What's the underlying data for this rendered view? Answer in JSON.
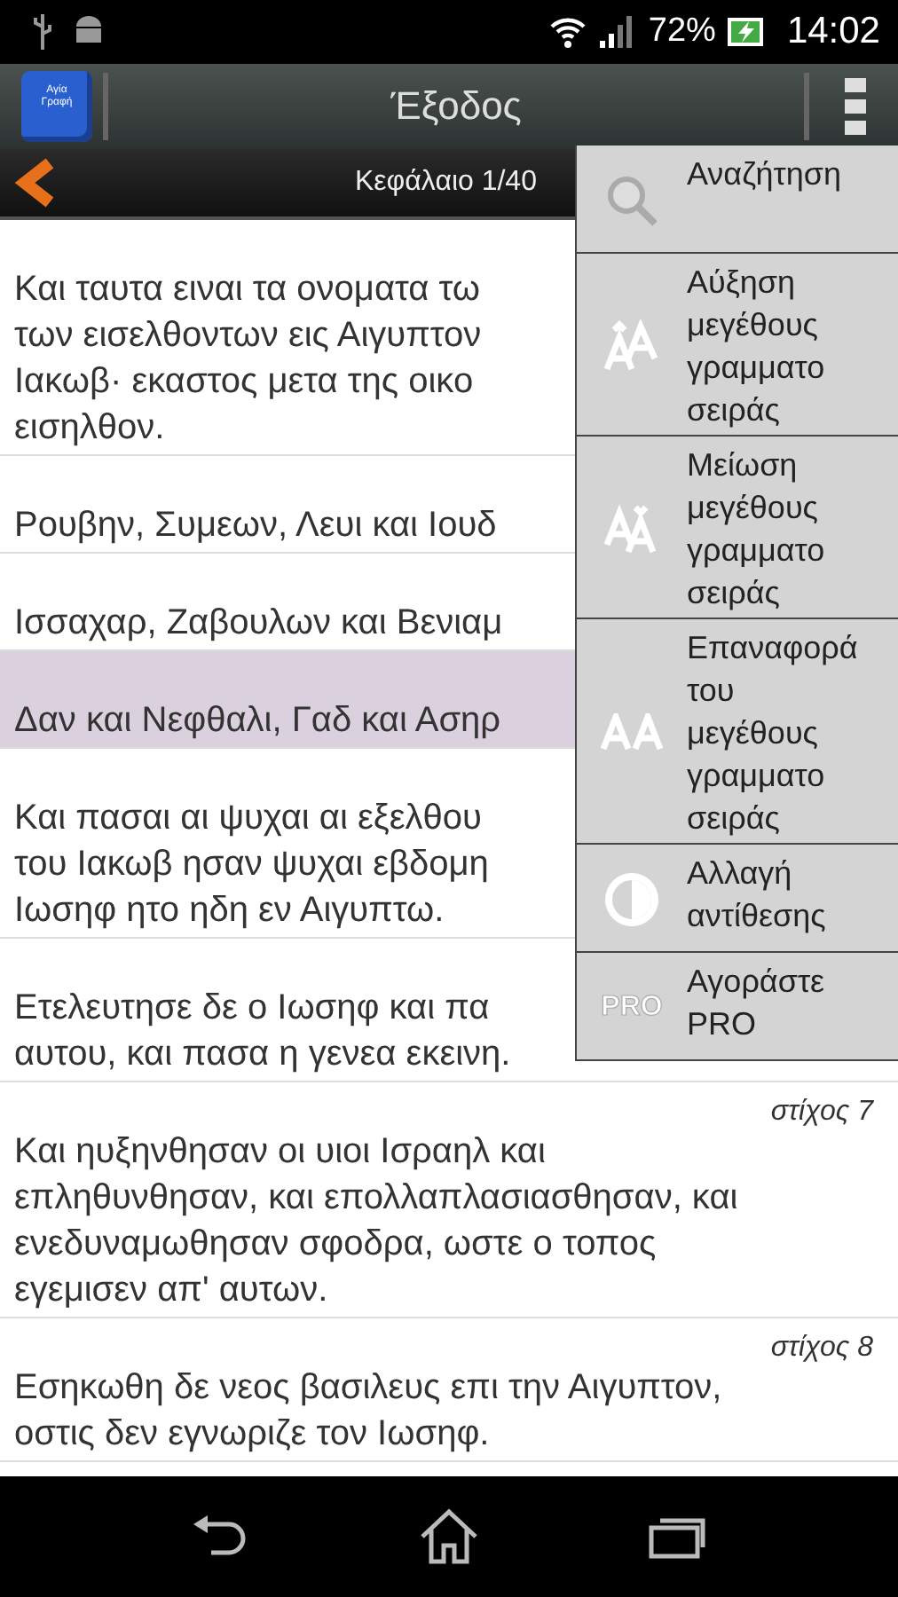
{
  "status_bar": {
    "battery": "72%",
    "time": "14:02"
  },
  "action_bar": {
    "logo_text": "Αγία Γραφή",
    "title": "Έξοδος"
  },
  "chapter_bar": {
    "label": "Κεφάλαιο 1/40"
  },
  "verses": [
    {
      "selected": false,
      "lines": [
        "Και ταυτα ειναι τα ονοματα τω",
        "των εισελθοντων εις Αιγυπτον",
        "Ιακωβ· εκαστος μετα της οικο",
        "εισηλθον."
      ]
    },
    {
      "selected": false,
      "lines": [
        "Ρουβην, Συμεων, Λευι και Ιουδ"
      ]
    },
    {
      "selected": false,
      "lines": [
        "Ισσαχαρ, Ζαβουλων και Βενιαμ"
      ]
    },
    {
      "selected": true,
      "lines": [
        "Δαν και Νεφθαλι, Γαδ και Ασηρ"
      ]
    },
    {
      "selected": false,
      "lines": [
        "Και πασαι αι ψυχαι αι εξελθου",
        "του Ιακωβ ησαν ψυχαι εβδομη",
        "Ιωσηφ ητο ηδη εν Αιγυπτω."
      ]
    },
    {
      "selected": false,
      "lines": [
        "Ετελευτησε δε ο Ιωσηφ και πα",
        "αυτου, και πασα η γενεα εκεινη."
      ]
    },
    {
      "label": "στίχος 7",
      "selected": false,
      "lines": [
        "Και ηυξηνθησαν οι υιοι Ισραηλ και",
        "επληθυνθησαν, και επολλαπλασιασθησαν, και",
        "ενεδυναμωθησαν σφοδρα, ωστε ο τοπος",
        "εγεμισεν απ' αυτων."
      ]
    },
    {
      "label": "στίχος 8",
      "selected": false,
      "lines": [
        "Εσηκωθη δε νεος βασιλευς επι την Αιγυπτον,",
        "οστις δεν εγνωριζε τον Ιωσηφ."
      ]
    }
  ],
  "menu": [
    {
      "kind": "search",
      "lines": [
        "Αναζήτηση"
      ]
    },
    {
      "kind": "font-up",
      "lines": [
        "Αύξηση",
        "μεγέθους",
        "γραμματο",
        "σειράς"
      ]
    },
    {
      "kind": "font-down",
      "lines": [
        "Μείωση",
        "μεγέθους",
        "γραμματο",
        "σειράς"
      ]
    },
    {
      "kind": "font-reset",
      "lines": [
        "Επαναφορά",
        "του",
        "μεγέθους",
        "γραμματο",
        "σειράς"
      ]
    },
    {
      "kind": "contrast",
      "lines": [
        "Αλλαγή",
        "αντίθεσης"
      ]
    },
    {
      "kind": "pro",
      "icon_text": "PRO",
      "lines": [
        "Αγοράστε",
        "PRO"
      ]
    }
  ]
}
